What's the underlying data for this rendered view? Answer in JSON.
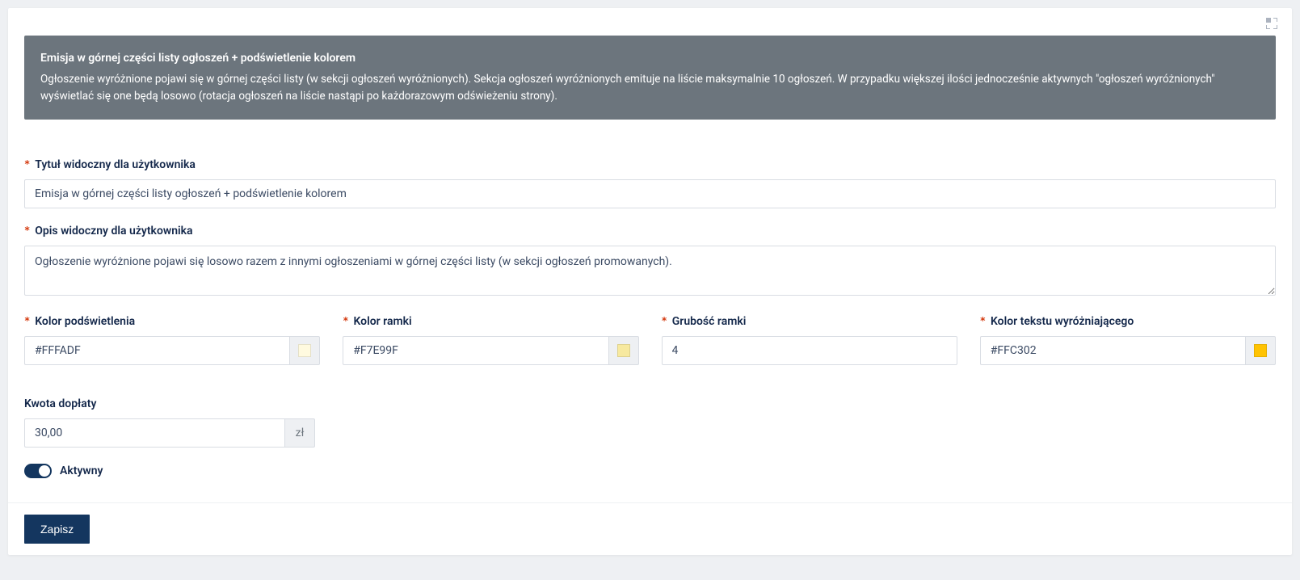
{
  "info_box": {
    "title": "Emisja w górnej części listy ogłoszeń + podświetlenie kolorem",
    "description": "Ogłoszenie wyróżnione pojawi się w górnej części listy (w sekcji ogłoszeń wyróżnionych). Sekcja ogłoszeń wyróżnionych emituje na liście maksymalnie 10 ogłoszeń. W przypadku większej ilości jednocześnie aktywnych \"ogłoszeń wyróżnionych\" wyświetlać się one będą losowo (rotacja ogłoszeń na liście nastąpi po każdorazowym odświeżeniu strony)."
  },
  "labels": {
    "title_visible": "Tytuł widoczny dla użytkownika",
    "desc_visible": "Opis widoczny dla użytkownika",
    "highlight_color": "Kolor podświetlenia",
    "border_color": "Kolor ramki",
    "border_width": "Grubość ramki",
    "text_color": "Kolor tekstu wyróżniającego",
    "amount": "Kwota dopłaty",
    "currency": "zł",
    "active": "Aktywny",
    "save": "Zapisz"
  },
  "values": {
    "title_visible": "Emisja w górnej części listy ogłoszeń + podświetlenie kolorem",
    "desc_visible": "Ogłoszenie wyróżnione pojawi się losowo razem z innymi ogłoszeniami w górnej części listy (w sekcji ogłoszeń promowanych).",
    "highlight_color": "#FFFADF",
    "border_color": "#F7E99F",
    "border_width": "4",
    "text_color": "#FFC302",
    "amount": "30,00",
    "active": true
  },
  "colors": {
    "highlight_swatch": "#FFFADF",
    "border_swatch": "#F7E99F",
    "text_swatch": "#FFC302"
  }
}
